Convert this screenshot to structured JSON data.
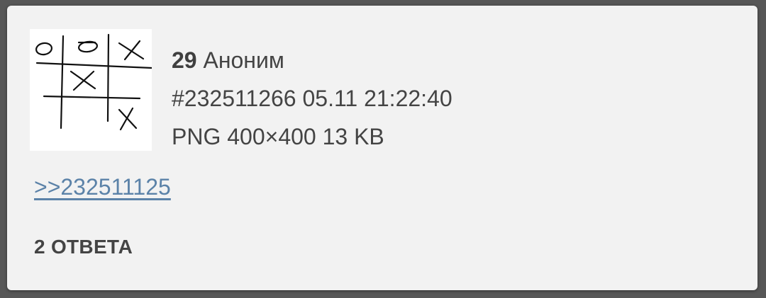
{
  "post": {
    "number": "29",
    "author": "Аноним",
    "post_id": "#232511266",
    "date": "05.11",
    "time": "21:22:40",
    "file_info": "PNG 400×400 13 KB",
    "reply_link": ">>232511125",
    "replies_label": "2 ОТВЕТА",
    "thumbnail": {
      "icon": "tic-tac-toe-drawing",
      "cells": [
        "O",
        "O",
        "X",
        "",
        "X",
        "",
        "",
        "",
        "X"
      ]
    }
  },
  "colors": {
    "card_bg": "#f2f2f2",
    "text": "#444444",
    "link": "#5b82a8"
  }
}
